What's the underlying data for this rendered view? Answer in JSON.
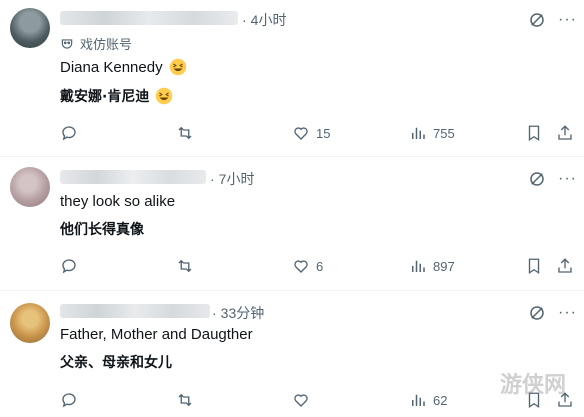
{
  "posts": [
    {
      "time_dot": "·",
      "time": "4小时",
      "badge": "戏仿账号",
      "lines": [
        "Diana Kennedy",
        "戴安娜·肯尼迪"
      ],
      "stats": {
        "likes": "15",
        "views": "755"
      },
      "colors": {
        "avatar": "#5a6a6e"
      }
    },
    {
      "time_dot": "·",
      "time": "7小时",
      "lines": [
        "they look so alike",
        "他们长得真像"
      ],
      "stats": {
        "likes": "6",
        "views": "897"
      },
      "colors": {
        "avatar": "#b7a3a5"
      }
    },
    {
      "time_dot": "·",
      "time": "33分钟",
      "lines": [
        "Father, Mother and Daugther",
        "父亲、母亲和女儿"
      ],
      "stats": {
        "likes": "",
        "views": "62"
      },
      "colors": {
        "avatar": "#d2a65a"
      }
    }
  ],
  "icons": {
    "reply": "reply-icon",
    "repost": "repost-icon",
    "like": "like-icon",
    "views": "views-icon",
    "bookmark": "bookmark-icon",
    "share": "share-icon",
    "grok": "grok-icon",
    "more": "more-icon"
  },
  "watermark": "游侠网",
  "colors": {
    "muted": "#536471",
    "text": "#0f1419",
    "divider": "#eff3f4"
  }
}
